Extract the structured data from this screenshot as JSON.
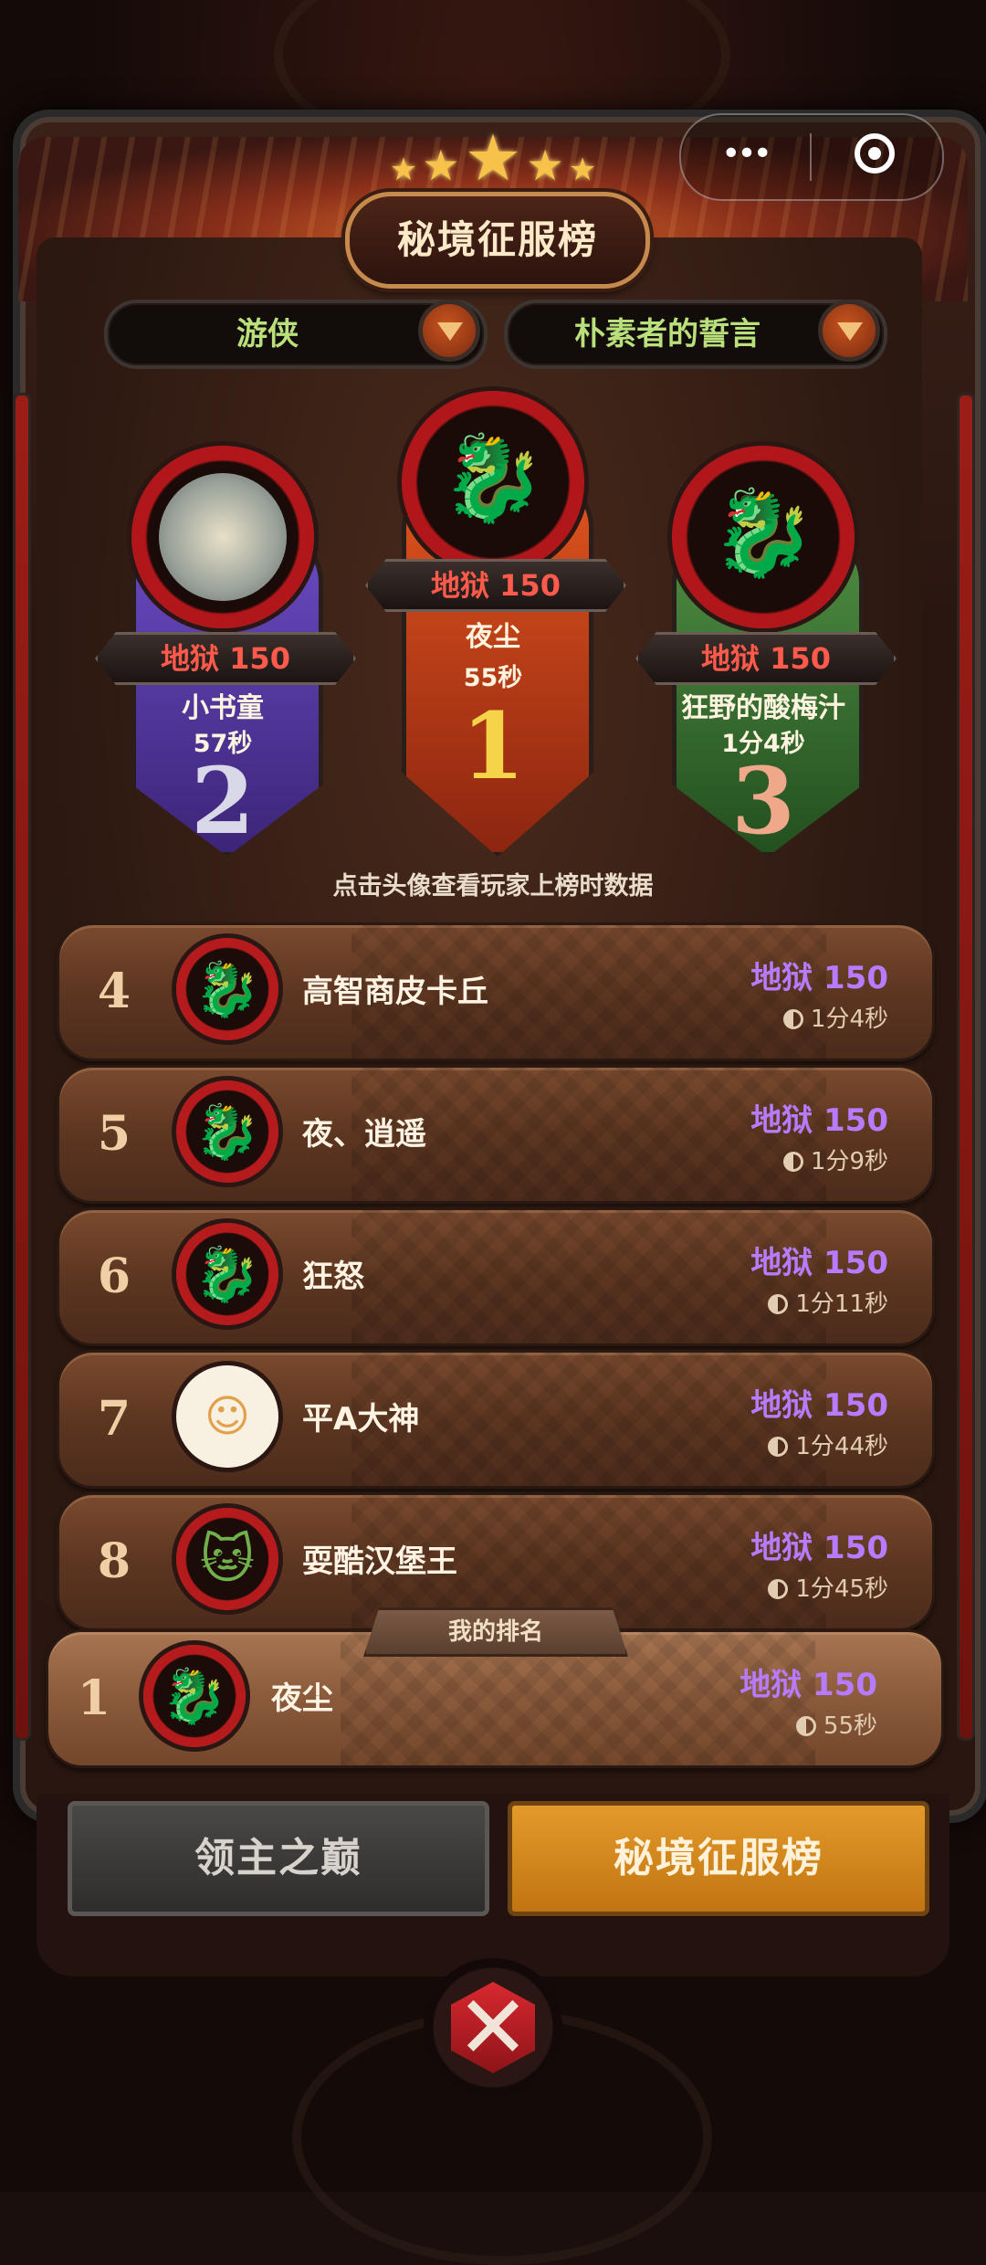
{
  "header": {
    "title": "秘境征服榜",
    "capsule_dots": "•••"
  },
  "filters": {
    "class_value": "游侠",
    "mode_value": "朴素者的誓言"
  },
  "podium": [
    {
      "rank": "1",
      "score": "地狱 150",
      "name": "夜尘",
      "time": "55秒",
      "avatar": "red-dragon",
      "color": "#c53818"
    },
    {
      "rank": "2",
      "score": "地狱 150",
      "name": "小书童",
      "time": "57秒",
      "avatar": "ink-painting",
      "color": "#5c3fa8"
    },
    {
      "rank": "3",
      "score": "地狱 150",
      "name": "狂野的酸梅汁",
      "time": "1分4秒",
      "avatar": "red-dragon",
      "color": "#3c7a35"
    }
  ],
  "hint": "点击头像查看玩家上榜时数据",
  "rows": [
    {
      "rank": "4",
      "name": "高智商皮卡丘",
      "score": "地狱 150",
      "time": "1分4秒",
      "avatar": "dragon-green-frame"
    },
    {
      "rank": "5",
      "name": "夜、逍遥",
      "score": "地狱 150",
      "time": "1分9秒",
      "avatar": "dragon-red-frame"
    },
    {
      "rank": "6",
      "name": "狂怒",
      "score": "地狱 150",
      "time": "1分11秒",
      "avatar": "dragon-green-frame"
    },
    {
      "rank": "7",
      "name": "平A大神",
      "score": "地狱 150",
      "time": "1分44秒",
      "avatar": "cartoon-kid"
    },
    {
      "rank": "8",
      "name": "耍酷汉堡王",
      "score": "地狱 150",
      "time": "1分45秒",
      "avatar": "cat-red-frame"
    }
  ],
  "my_rank": {
    "tag": "我的排名",
    "rank": "1",
    "name": "夜尘",
    "score": "地狱 150",
    "time": "55秒"
  },
  "tabs": {
    "lord": "领主之巅",
    "realm": "秘境征服榜"
  },
  "colors": {
    "score_purple": "#b77bff",
    "tab_active": "#e39a2a",
    "filter_text": "#b9e07a"
  }
}
